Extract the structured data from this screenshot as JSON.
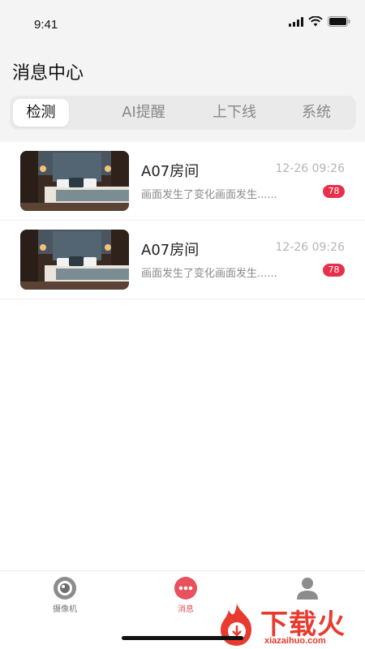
{
  "status_bar": {
    "time": "9:41"
  },
  "header": {
    "title": "消息中心"
  },
  "tabs": [
    {
      "label": "检测",
      "active": true
    },
    {
      "label": "AI提醒",
      "active": false
    },
    {
      "label": "上下线",
      "active": false
    },
    {
      "label": "系统",
      "active": false
    }
  ],
  "messages": [
    {
      "title": "A07房间",
      "time": "12-26 09:26",
      "description": "画面发生了变化画面发生......",
      "badge": "78",
      "thumbnail": "bedroom-photo"
    },
    {
      "title": "A07房间",
      "time": "12-26 09:26",
      "description": "画面发生了变化画面发生......",
      "badge": "78",
      "thumbnail": "bedroom-photo"
    }
  ],
  "bottom_nav": [
    {
      "label": "摄像机",
      "icon": "camera-icon",
      "active": false
    },
    {
      "label": "消息",
      "icon": "message-icon",
      "active": true
    },
    {
      "label": "",
      "icon": "profile-icon",
      "active": false
    }
  ],
  "watermark": {
    "text": "下载火",
    "subtext": "xiazaihuo.com"
  },
  "colors": {
    "accent": "#e8515e",
    "badge": "#e8304a",
    "watermark": "#e83a2e"
  }
}
